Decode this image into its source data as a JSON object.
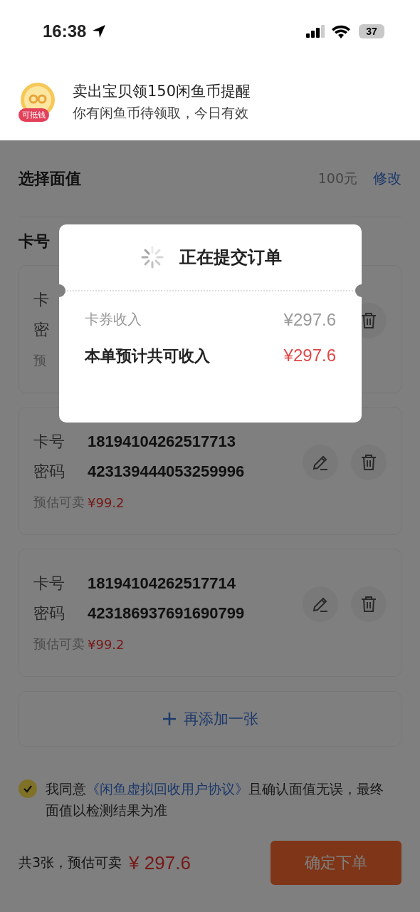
{
  "status_bar": {
    "time": "16:38",
    "battery": "37"
  },
  "banner": {
    "badge": "可抵钱",
    "title": "卖出宝贝领150闲鱼币提醒",
    "subtitle": "你有闲鱼币待领取，今日有效"
  },
  "face_value": {
    "label": "选择面值",
    "value": "100元",
    "action": "修改"
  },
  "section_title": "卡号",
  "cards": [
    {
      "number_label": "卡",
      "password_label": "密",
      "estimate_label": "预"
    },
    {
      "number_label": "卡号",
      "number": "18194104262517713",
      "password_label": "密码",
      "password": "423139444053259996",
      "estimate_label": "预估可卖",
      "estimate": "¥99.2"
    },
    {
      "number_label": "卡号",
      "number": "18194104262517714",
      "password_label": "密码",
      "password": "423186937691690799",
      "estimate_label": "预估可卖",
      "estimate": "¥99.2"
    }
  ],
  "add_button": "再添加一张",
  "agreement": {
    "checked": true,
    "prefix": "我同意",
    "link": "《闲鱼虚拟回收用户协议》",
    "suffix": "且确认面值无误，最终面值以检测结果为准"
  },
  "footer": {
    "summary": "共3张，预估可卖",
    "total": "¥ 297.6",
    "button": "确定下单"
  },
  "modal": {
    "title": "正在提交订单",
    "rows": [
      {
        "kind": "normal",
        "label": "卡券收入",
        "value": "¥297.6"
      },
      {
        "kind": "total",
        "label": "本单预计共可收入",
        "value": "¥297.6"
      }
    ]
  }
}
